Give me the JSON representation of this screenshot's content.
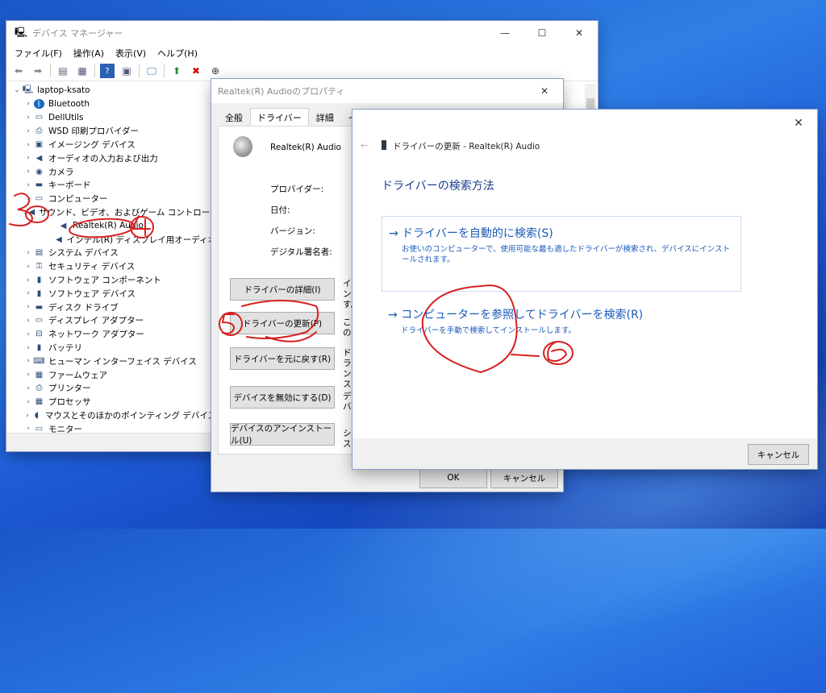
{
  "device_manager": {
    "title": "デバイス マネージャー",
    "menu": [
      "ファイル(F)",
      "操作(A)",
      "表示(V)",
      "ヘルプ(H)"
    ],
    "tree": [
      {
        "label": "laptop-ksato",
        "icon": "computer-icon",
        "expanded": true
      },
      {
        "label": "Bluetooth",
        "icon": "bluetooth-icon"
      },
      {
        "label": "DellUtils",
        "icon": "monitor-icon"
      },
      {
        "label": "WSD 印刷プロバイダー",
        "icon": "printer-icon"
      },
      {
        "label": "イメージング デバイス",
        "icon": "camera-icon"
      },
      {
        "label": "オーディオの入力および出力",
        "icon": "speaker-icon"
      },
      {
        "label": "カメラ",
        "icon": "webcam-icon"
      },
      {
        "label": "キーボード",
        "icon": "keyboard-icon"
      },
      {
        "label": "コンピューター",
        "icon": "monitor-icon"
      },
      {
        "label": "サウンド、ビデオ、およびゲーム コントローラー",
        "icon": "speaker-icon",
        "expanded": true
      },
      {
        "label": "Realtek(R) Audio",
        "icon": "speaker-icon",
        "child": true
      },
      {
        "label": "インテル(R) ディスプレイ用オーディオ",
        "icon": "speaker-icon",
        "child": true
      },
      {
        "label": "システム デバイス",
        "icon": "folder-icon"
      },
      {
        "label": "セキュリティ デバイス",
        "icon": "key-icon"
      },
      {
        "label": "ソフトウェア コンポーネント",
        "icon": "component-icon"
      },
      {
        "label": "ソフトウェア デバイス",
        "icon": "component-icon"
      },
      {
        "label": "ディスク ドライブ",
        "icon": "disk-icon"
      },
      {
        "label": "ディスプレイ アダプター",
        "icon": "monitor-icon"
      },
      {
        "label": "ネットワーク アダプター",
        "icon": "network-icon"
      },
      {
        "label": "バッテリ",
        "icon": "battery-icon"
      },
      {
        "label": "ヒューマン インターフェイス デバイス",
        "icon": "hid-icon"
      },
      {
        "label": "ファームウェア",
        "icon": "chip-icon"
      },
      {
        "label": "プリンター",
        "icon": "printer-icon"
      },
      {
        "label": "プロセッサ",
        "icon": "chip-icon"
      },
      {
        "label": "マウスとそのほかのポインティング デバイス",
        "icon": "mouse-icon"
      },
      {
        "label": "モニター",
        "icon": "monitor-icon"
      }
    ]
  },
  "properties": {
    "title": "Realtek(R) Audioのプロパティ",
    "tabs": [
      "全般",
      "ドライバー",
      "詳細",
      "イベ"
    ],
    "active_tab": "ドライバー",
    "device_name": "Realtek(R) Audio",
    "fields": [
      "プロバイダー:",
      "日付:",
      "バージョン:",
      "デジタル署名者:"
    ],
    "buttons": [
      {
        "label": "ドライバーの詳細(I)",
        "desc": "インす。"
      },
      {
        "label": "ドライバーの更新(P)",
        "desc": "この"
      },
      {
        "label": "ドライバーを元に戻す(R)",
        "desc": "ドラ ンス"
      },
      {
        "label": "デバイスを無効にする(D)",
        "desc": "デバ"
      },
      {
        "label": "デバイスのアンインストール(U)",
        "desc": "シス"
      }
    ],
    "ok": "OK",
    "cancel": "キャンセル"
  },
  "update_wizard": {
    "title": "ドライバーの更新 - Realtek(R) Audio",
    "heading": "ドライバーの検索方法",
    "options": [
      {
        "label": "→ ドライバーを自動的に検索(S)",
        "desc": "お使いのコンピューターで、使用可能な最も適したドライバーが検索され、デバイスにインストールされます。"
      },
      {
        "label": "→ コンピューターを参照してドライバーを検索(R)",
        "desc": "ドライバーを手動で検索してインストールします。"
      }
    ],
    "cancel": "キャンセル"
  },
  "annotations": [
    "3",
    "4",
    "5",
    "6"
  ]
}
